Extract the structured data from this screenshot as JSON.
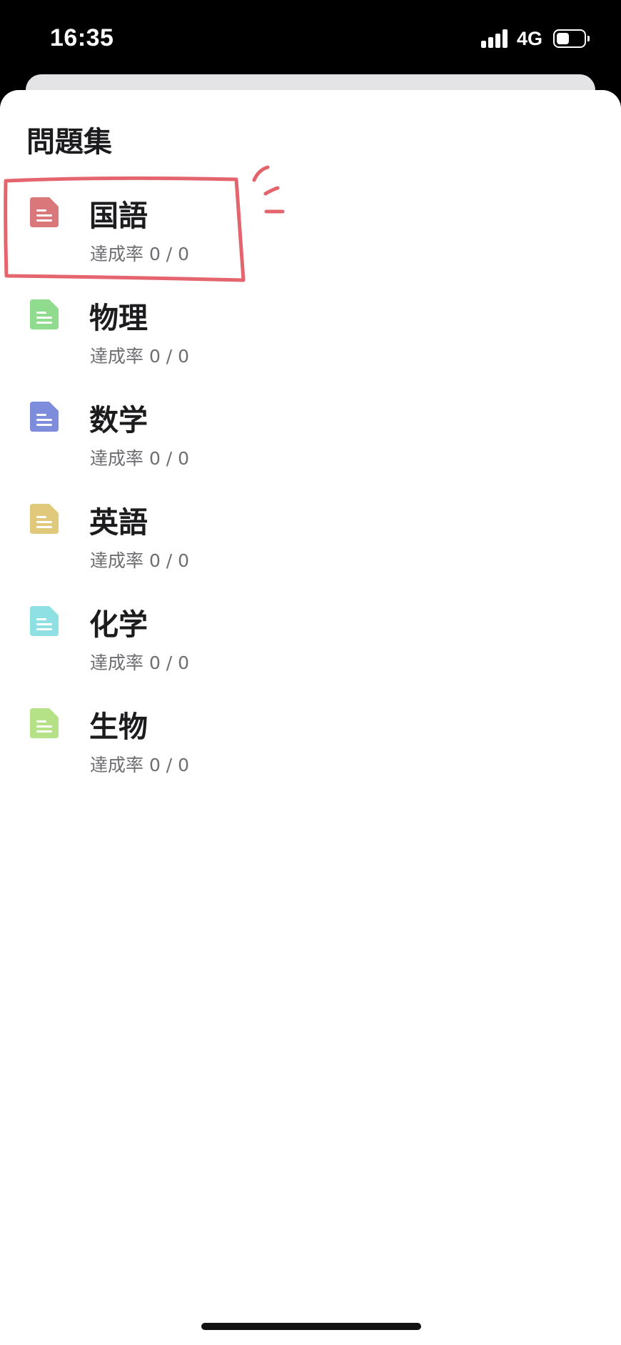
{
  "status_bar": {
    "time": "16:35",
    "network": "4G",
    "battery_level": 0.5,
    "signal_bars": 4
  },
  "sheet": {
    "title": "問題集"
  },
  "books": [
    {
      "title": "国語",
      "progress": "達成率 0 / 0",
      "icon": "document-icon",
      "color": "#d9777a"
    },
    {
      "title": "物理",
      "progress": "達成率 0 / 0",
      "icon": "document-icon",
      "color": "#8fdc8f"
    },
    {
      "title": "数学",
      "progress": "達成率 0 / 0",
      "icon": "document-icon",
      "color": "#7e8ddb"
    },
    {
      "title": "英語",
      "progress": "達成率 0 / 0",
      "icon": "document-icon",
      "color": "#e0c97a"
    },
    {
      "title": "化学",
      "progress": "達成率 0 / 0",
      "icon": "document-icon",
      "color": "#8fe0e3"
    },
    {
      "title": "生物",
      "progress": "達成率 0 / 0",
      "icon": "document-icon",
      "color": "#b5e286"
    }
  ],
  "annotation_color": "#e04a55"
}
